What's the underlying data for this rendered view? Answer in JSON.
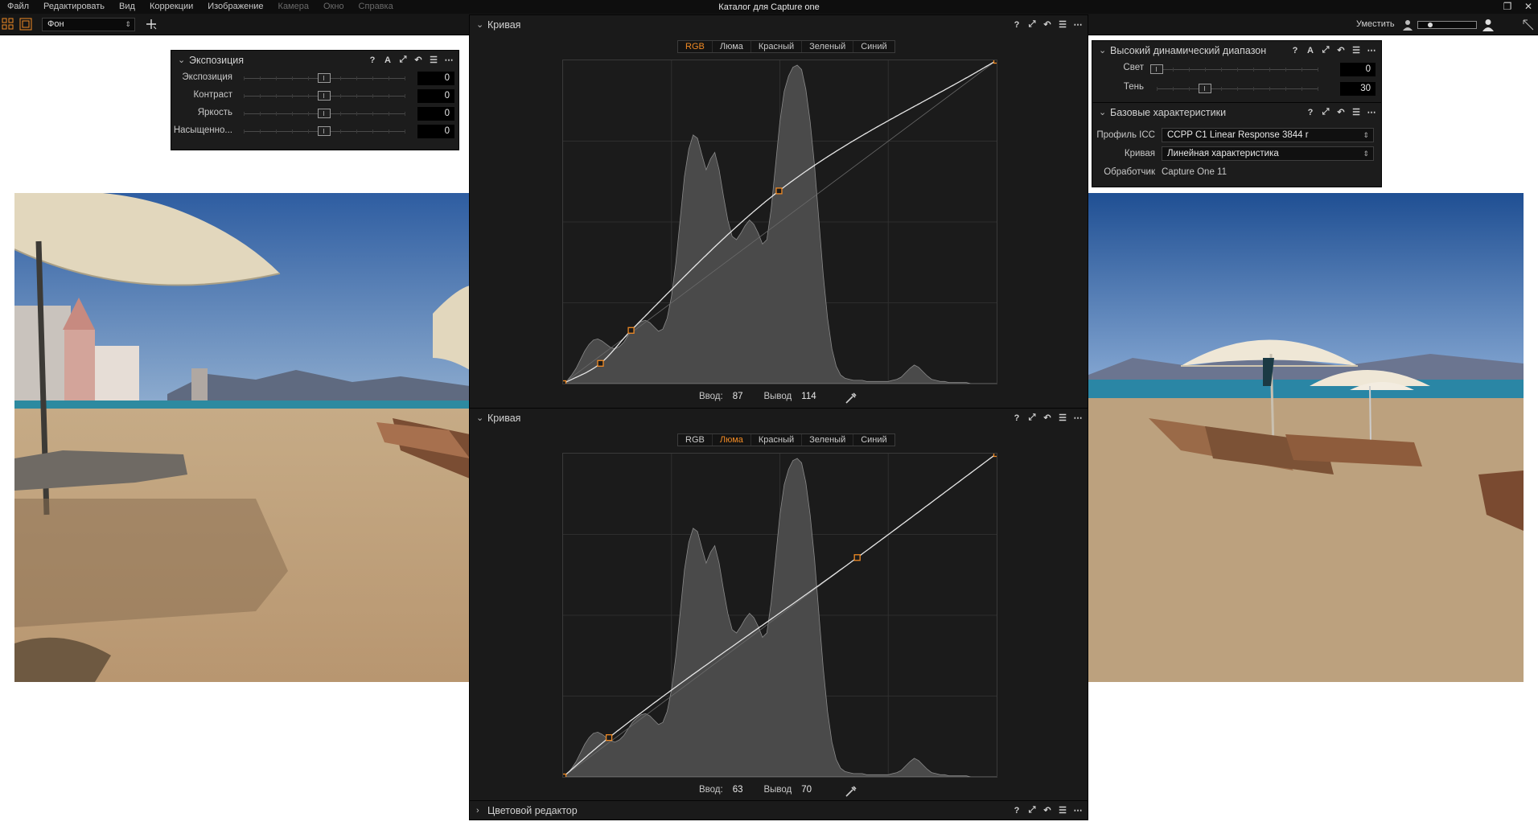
{
  "menubar": {
    "items": [
      {
        "label": "Файл",
        "disabled": false
      },
      {
        "label": "Редактировать",
        "disabled": false
      },
      {
        "label": "Вид",
        "disabled": false
      },
      {
        "label": "Коррекции",
        "disabled": false
      },
      {
        "label": "Изображение",
        "disabled": false
      },
      {
        "label": "Камера",
        "disabled": true
      },
      {
        "label": "Окно",
        "disabled": true
      },
      {
        "label": "Справка",
        "disabled": true
      }
    ],
    "window_title": "Каталог для Capture one",
    "restore_glyph": "❐",
    "close_glyph": "✕"
  },
  "toolbar": {
    "layer_select": "Фон",
    "fit_label": "Уместить",
    "zoom_level": 0.18
  },
  "exposure_panel": {
    "title": "Экспозиция",
    "tools": [
      "?",
      "A",
      "⤢",
      "↶",
      "☰",
      "⋯"
    ],
    "rows": [
      {
        "label": "Экспозиция",
        "value": "0",
        "level": 0.5
      },
      {
        "label": "Контраст",
        "value": "0",
        "level": 0.5
      },
      {
        "label": "Яркость",
        "value": "0",
        "level": 0.5
      },
      {
        "label": "Насыщенно...",
        "value": "0",
        "level": 0.5
      }
    ]
  },
  "curve_panel_1": {
    "title": "Кривая",
    "tools": [
      "?",
      "⤢",
      "↶",
      "☰",
      "⋯"
    ],
    "tabs": [
      "RGB",
      "Люма",
      "Красный",
      "Зеленый",
      "Синий"
    ],
    "active_tab": 0,
    "input_label": "Ввод:",
    "input_value": "87",
    "output_label": "Вывод",
    "output_value": "114",
    "points": [
      [
        0,
        0
      ],
      [
        22,
        16
      ],
      [
        40,
        42
      ],
      [
        127,
        152
      ],
      [
        255,
        255
      ]
    ]
  },
  "curve_panel_2": {
    "title": "Кривая",
    "tools": [
      "?",
      "⤢",
      "↶",
      "☰",
      "⋯"
    ],
    "tabs": [
      "RGB",
      "Люма",
      "Красный",
      "Зеленый",
      "Синий"
    ],
    "active_tab": 1,
    "input_label": "Ввод:",
    "input_value": "63",
    "output_label": "Вывод",
    "output_value": "70",
    "points": [
      [
        0,
        0
      ],
      [
        27,
        31
      ],
      [
        173,
        173
      ],
      [
        255,
        255
      ]
    ]
  },
  "color_editor": {
    "title": "Цветовой редактор",
    "tools": [
      "?",
      "⤢",
      "↶",
      "☰",
      "⋯"
    ]
  },
  "hdr_panel": {
    "title": "Высокий динамический диапазон",
    "tools": [
      "?",
      "A",
      "⤢",
      "↶",
      "☰",
      "⋯"
    ],
    "rows": [
      {
        "label": "Свет",
        "value": "0",
        "level": 0.0
      },
      {
        "label": "Тень",
        "value": "30",
        "level": 0.3
      }
    ]
  },
  "base_panel": {
    "title": "Базовые характеристики",
    "tools": [
      "?",
      "⤢",
      "↶",
      "☰",
      "⋯"
    ],
    "icc_label": "Профиль ICC",
    "icc_value": "CCPP C1 Linear Response 3844 r",
    "curve_label": "Кривая",
    "curve_value": "Линейная характеристика",
    "engine_label": "Обработчик",
    "engine_value": "Capture One 11"
  },
  "colors": {
    "accent": "#f08a24",
    "panel_bg": "#1c1c1c",
    "histogram": "#4a4a4a"
  },
  "histogram": [
    0,
    3,
    8,
    14,
    22,
    30,
    36,
    40,
    41,
    39,
    36,
    33,
    32,
    34,
    38,
    44,
    50,
    54,
    57,
    58,
    56,
    52,
    48,
    50,
    60,
    80,
    110,
    150,
    190,
    215,
    228,
    225,
    210,
    196,
    206,
    212,
    196,
    172,
    150,
    135,
    132,
    138,
    145,
    150,
    146,
    138,
    128,
    132,
    160,
    200,
    240,
    268,
    282,
    290,
    292,
    288,
    270,
    240,
    200,
    150,
    100,
    60,
    32,
    16,
    8,
    5,
    4,
    3,
    3,
    3,
    2,
    2,
    2,
    2,
    2,
    2,
    3,
    4,
    6,
    10,
    14,
    17,
    15,
    11,
    7,
    4,
    3,
    2,
    2,
    1,
    1,
    1,
    1,
    1,
    0,
    0,
    0,
    0,
    0,
    0,
    0
  ]
}
